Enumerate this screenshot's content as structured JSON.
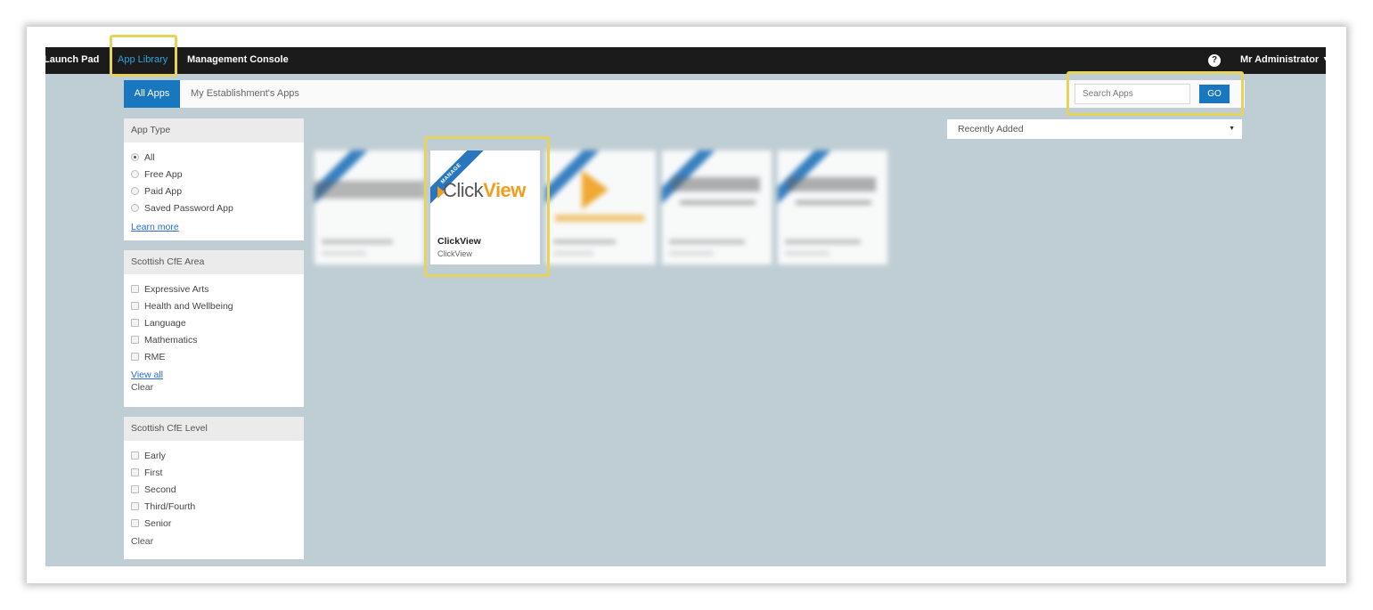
{
  "topbar": {
    "launch_pad": "Launch Pad",
    "app_library": "App Library",
    "management_console": "Management Console",
    "help_icon": "?",
    "user_name": "Mr Administrator"
  },
  "tabs": {
    "all_apps": "All Apps",
    "my_apps": "My Establishment's Apps"
  },
  "search": {
    "placeholder": "Search Apps",
    "go_label": "GO"
  },
  "filters": {
    "app_type": {
      "title": "App Type",
      "options": [
        "All",
        "Free App",
        "Paid App",
        "Saved Password App"
      ],
      "selected": "All",
      "learn_more": "Learn more"
    },
    "cfe_area": {
      "title": "Scottish CfE Area",
      "options": [
        "Expressive Arts",
        "Health and Wellbeing",
        "Language",
        "Mathematics",
        "RME"
      ],
      "view_all": "View all",
      "clear": "Clear"
    },
    "cfe_level": {
      "title": "Scottish CfE Level",
      "options": [
        "Early",
        "First",
        "Second",
        "Third/Fourth",
        "Senior"
      ],
      "clear": "Clear"
    }
  },
  "sort": {
    "selected": "Recently Added"
  },
  "apps": {
    "featured": {
      "ribbon": "MANAGE",
      "logo_click": "Click",
      "logo_view": "View",
      "name": "ClickView",
      "publisher": "ClickView"
    }
  },
  "colors": {
    "nav_bg": "#1b1b1b",
    "accent_blue": "#1877bf",
    "active_nav": "#2ea3dc",
    "page_bg": "#bfcdd4",
    "highlight": "#e8d35a",
    "clickview_orange": "#f29e1d"
  }
}
